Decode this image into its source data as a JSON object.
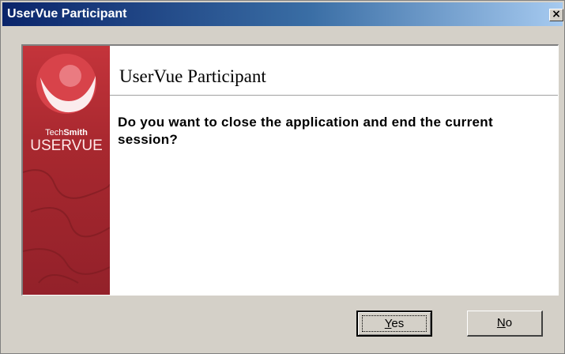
{
  "window": {
    "title": "UserVue Participant",
    "close_glyph": "×"
  },
  "sidebar": {
    "brand_small_1": "Tech",
    "brand_small_2": "Smith",
    "brand_big": "USERVUE"
  },
  "dialog": {
    "heading": "UserVue Participant",
    "message": "Do you want to close the application and end the current session?"
  },
  "buttons": {
    "yes": {
      "mnemonic": "Y",
      "rest": "es"
    },
    "no": {
      "mnemonic": "N",
      "rest": "o"
    }
  },
  "colors": {
    "titlebar_start": "#0a246a",
    "titlebar_end": "#a6caf0",
    "dialog_face": "#d4d0c8",
    "brand_red": "#c4343b"
  }
}
